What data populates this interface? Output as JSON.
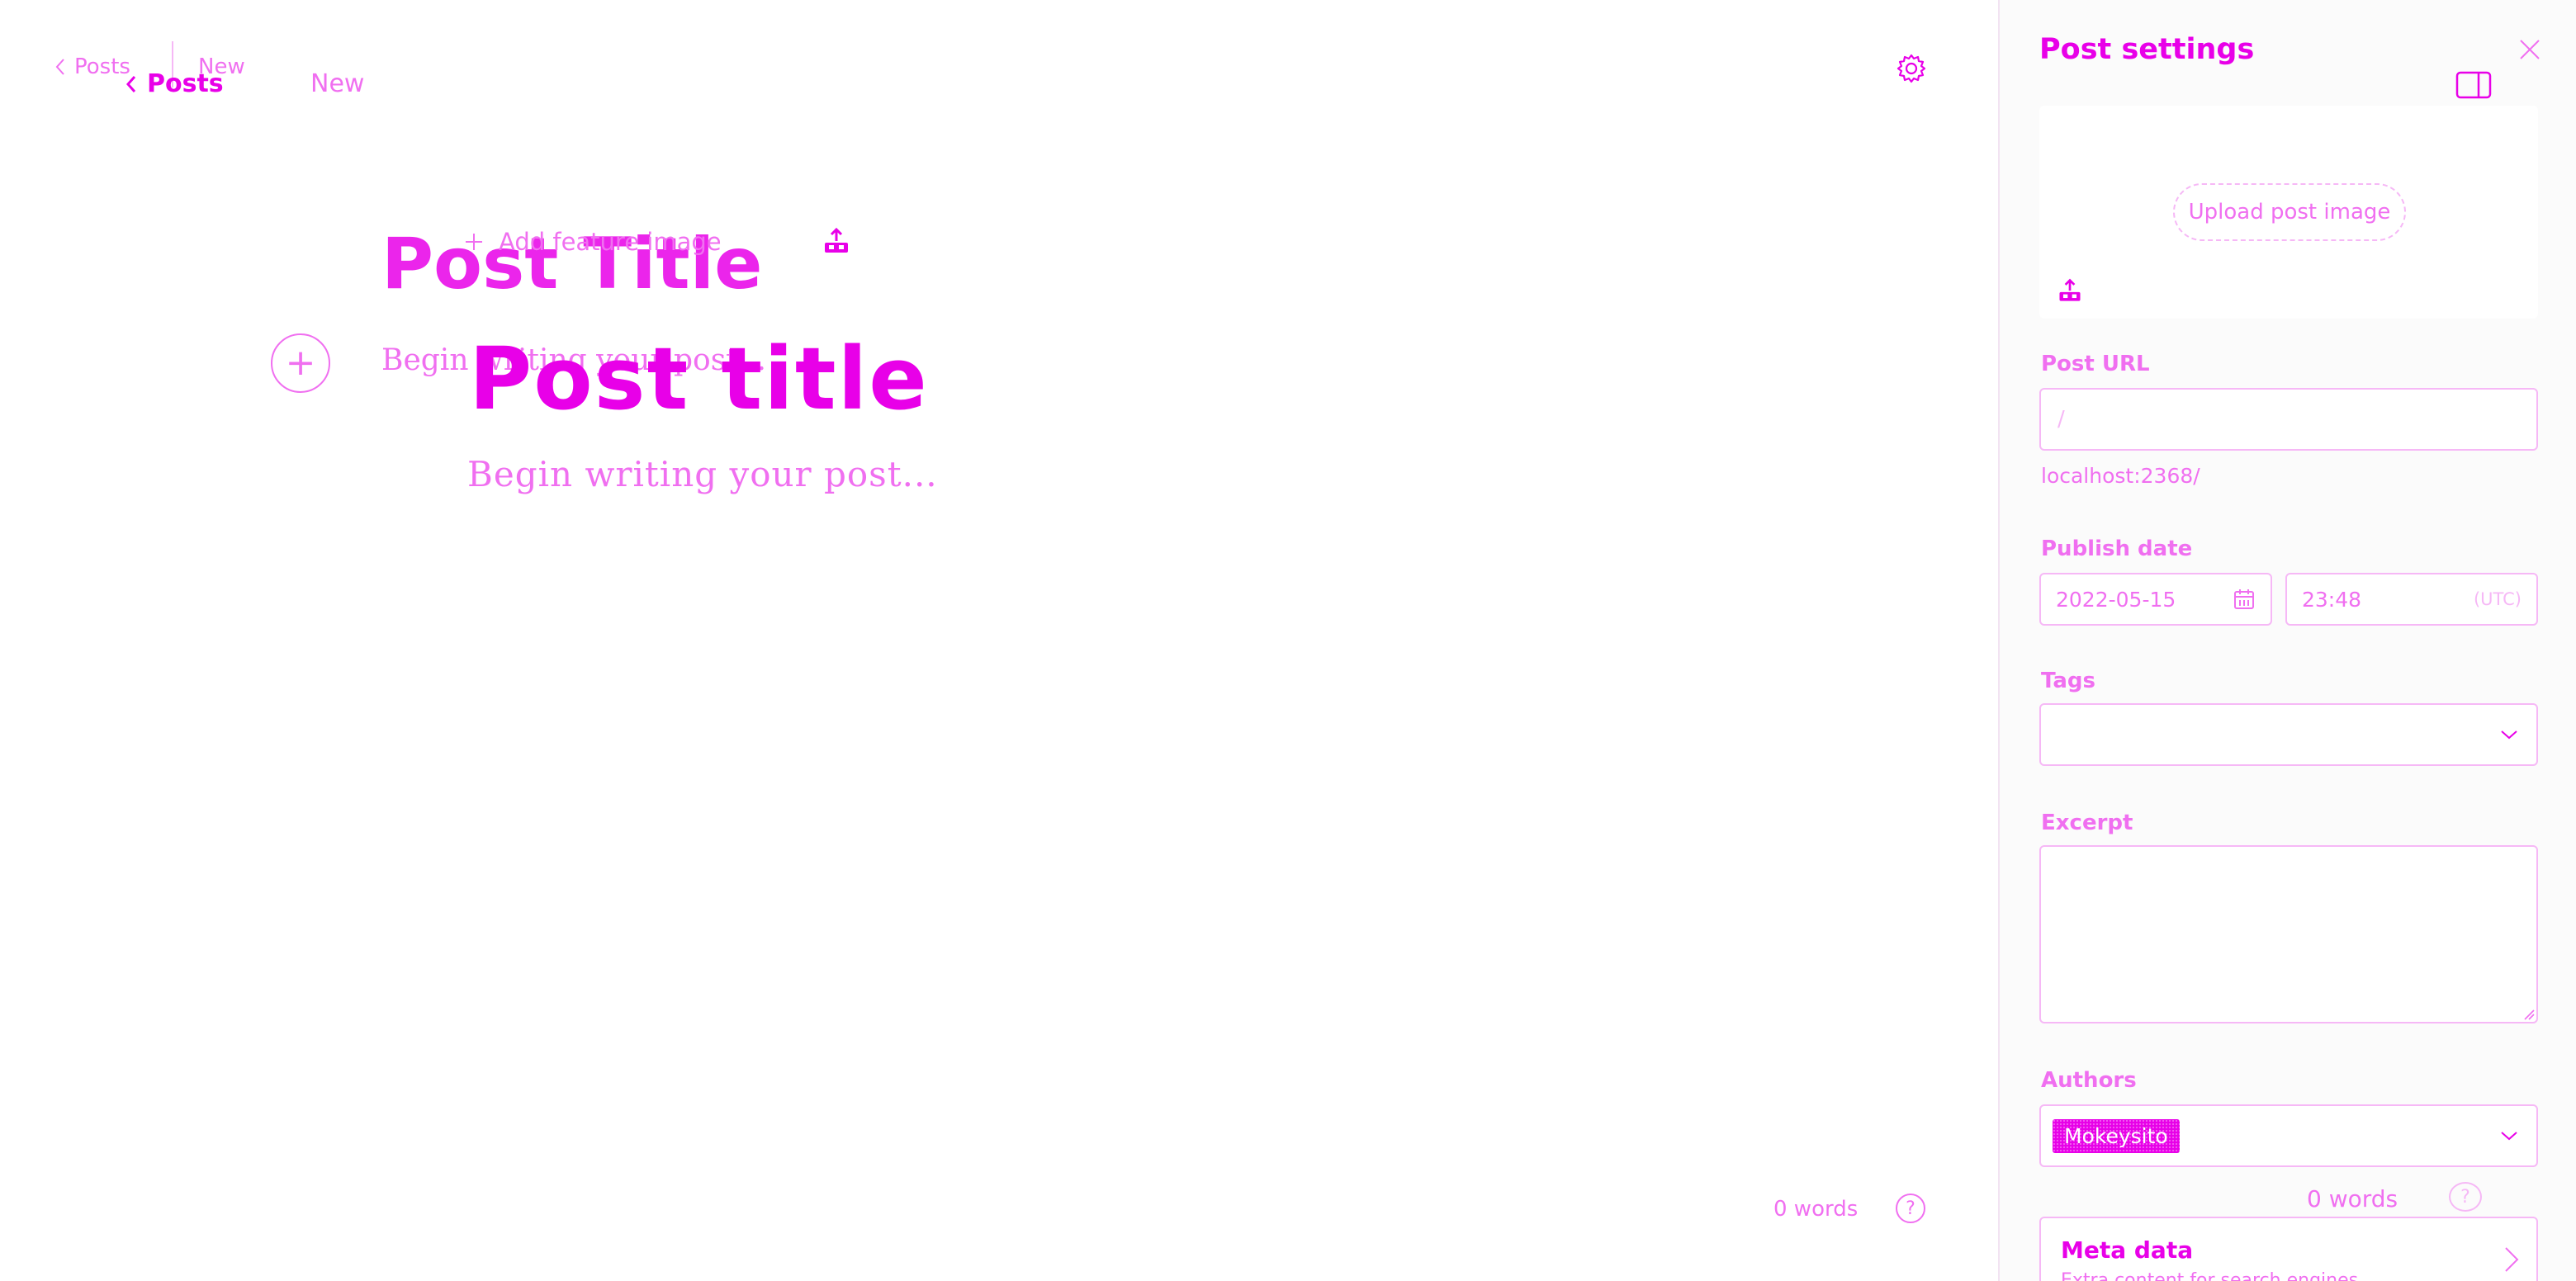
{
  "editor": {
    "nav_back_label": "Posts",
    "nav_ghost_status": "New",
    "nav_posts_label": "Posts",
    "nav_status": "New",
    "feature_image_label": "Add feature image",
    "title_placeholder_ghost": "Post Title",
    "body_placeholder_ghost": "Begin writing your post...",
    "title_placeholder": "Post title",
    "body_placeholder": "Begin writing your post...",
    "plus_glyph": "+",
    "word_count": "0 words",
    "help_glyph": "?"
  },
  "settings": {
    "title": "Post settings",
    "upload_button": "Upload post image",
    "url_label": "Post URL",
    "url_value": "/",
    "url_preview": "localhost:2368/",
    "publish_date_label": "Publish date",
    "date_value": "2022-05-15",
    "time_value": "23:48",
    "timezone": "(UTC)",
    "tags_label": "Tags",
    "excerpt_label": "Excerpt",
    "excerpt_value": "",
    "authors_label": "Authors",
    "author_name": "Mokeysito",
    "word_count": "0 words",
    "help_glyph": "?",
    "meta_title": "Meta data",
    "meta_subtitle": "Extra content for search engines"
  },
  "colors": {
    "accent": "#e800e8",
    "accent_pale": "#f06ff0",
    "accent_light": "#f6b8f6",
    "panel_bg": "#fbfbfb"
  },
  "icons": [
    "chevron-left-icon",
    "gear-icon",
    "plus-icon",
    "image-upload-icon",
    "close-icon",
    "sidebar-toggle-icon",
    "calendar-icon",
    "chevron-down-icon",
    "help-icon",
    "chevron-right-icon"
  ]
}
